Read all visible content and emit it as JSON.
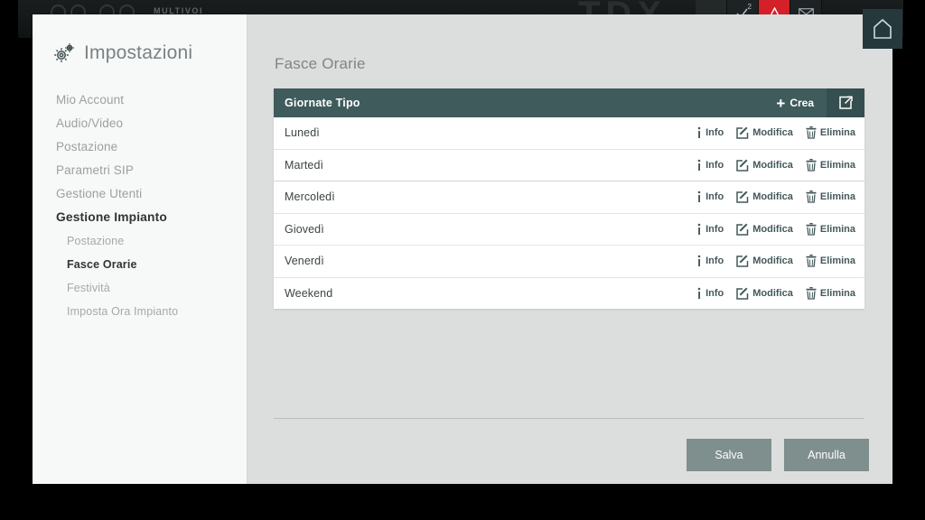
{
  "background": {
    "brand_sub": "MULTIVOI",
    "center_text": "TDX",
    "icons": [
      {
        "name": "blank-tile",
        "glyph": ""
      },
      {
        "name": "check-icon",
        "glyph": "✓",
        "badge": "2"
      },
      {
        "name": "alarm-warning-icon",
        "glyph": "⚠"
      },
      {
        "name": "mail-icon",
        "glyph": "✉"
      }
    ]
  },
  "home_button": {
    "icon": "home-icon",
    "label": ""
  },
  "sidebar": {
    "icon": "gear-icon",
    "title": "Impostazioni",
    "items": [
      {
        "label": "Mio Account",
        "level": "top",
        "state": "normal"
      },
      {
        "label": "Audio/Video",
        "level": "top",
        "state": "normal"
      },
      {
        "label": "Postazione",
        "level": "top",
        "state": "normal"
      },
      {
        "label": "Parametri SIP",
        "level": "top",
        "state": "normal"
      },
      {
        "label": "Gestione Utenti",
        "level": "top",
        "state": "normal"
      },
      {
        "label": "Gestione Impianto",
        "level": "top",
        "state": "active-parent"
      },
      {
        "label": "Postazione",
        "level": "sub",
        "state": "normal"
      },
      {
        "label": "Fasce Orarie",
        "level": "sub",
        "state": "active"
      },
      {
        "label": "Festività",
        "level": "sub",
        "state": "normal"
      },
      {
        "label": "Imposta Ora Impianto",
        "level": "sub",
        "state": "normal"
      }
    ]
  },
  "content": {
    "title": "Fasce Orarie",
    "table": {
      "header_label": "Giornate Tipo",
      "create_button": {
        "label": "Crea",
        "icon": "plus-icon"
      },
      "export_button": {
        "icon": "export-share-icon",
        "label": ""
      },
      "row_actions": [
        {
          "label": "Info",
          "icon": "info-icon"
        },
        {
          "label": "Modifica",
          "icon": "edit-pencil-icon"
        },
        {
          "label": "Elimina",
          "icon": "trash-icon"
        }
      ],
      "rows": [
        {
          "name": "Lunedì"
        },
        {
          "name": "Martedì"
        },
        {
          "name": "Mercoledì"
        },
        {
          "name": "Giovedì"
        },
        {
          "name": "Venerdì"
        },
        {
          "name": "Weekend"
        }
      ]
    },
    "footer": {
      "save_label": "Salva",
      "cancel_label": "Annulla"
    }
  },
  "colors": {
    "table_header": "#3f5b5c",
    "export_button": "#354e50",
    "footer_button": "#7f8f8d",
    "content_bg": "#dcdedd",
    "sidebar_bg": "#f7f8f8",
    "alarm_red": "#d42028"
  }
}
